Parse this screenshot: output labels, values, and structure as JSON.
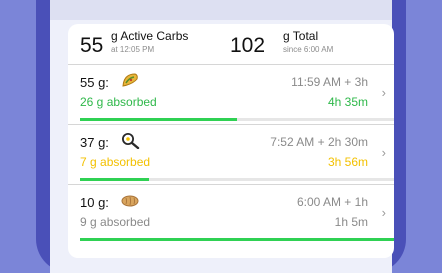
{
  "summary": {
    "active_value": "55",
    "active_label": "g Active Carbs",
    "active_time": "at 12:05 PM",
    "total_value": "102",
    "total_label": "g Total",
    "total_time": "since 6:00 AM"
  },
  "entries": [
    {
      "grams": "55 g:",
      "icon": "taco-icon",
      "time": "11:59 AM + 3h",
      "absorbed": "26 g absorbed",
      "remaining": "4h 35m",
      "absorbed_color": "#2fb84a",
      "remaining_color": "#2fb84a",
      "progress": 0.5
    },
    {
      "grams": "37 g:",
      "icon": "fried-egg-pan-icon",
      "time": "7:52 AM + 2h 30m",
      "absorbed": "7 g absorbed",
      "remaining": "3h 56m",
      "absorbed_color": "#f3c100",
      "remaining_color": "#f3c100",
      "progress": 0.22
    },
    {
      "grams": "10 g:",
      "icon": "bread-loaf-icon",
      "time": "6:00 AM + 1h",
      "absorbed": "9 g absorbed",
      "remaining": "1h 5m",
      "absorbed_color": "#8a8a8a",
      "remaining_color": "#8a8a8a",
      "progress": 1.0
    }
  ],
  "colors": {
    "background": "#7b85d8",
    "progress": "#2fd153",
    "fast_green": "#2fb84a",
    "medium_yellow": "#f3c100"
  }
}
